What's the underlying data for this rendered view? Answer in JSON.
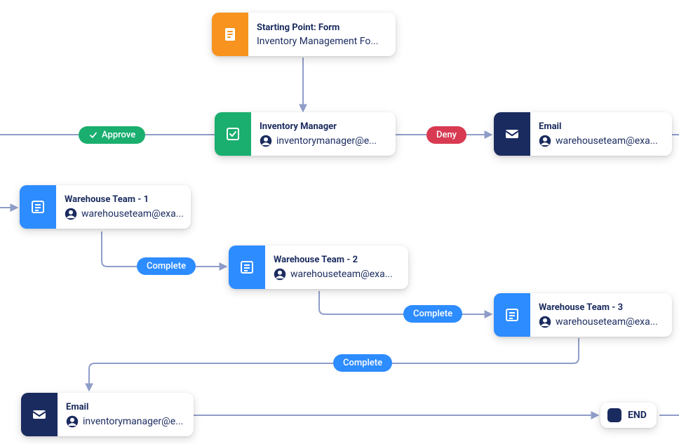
{
  "nodes": {
    "start": {
      "title": "Starting Point: Form",
      "subtitle": "Inventory Management Fo...",
      "iconBg": "#f7931e",
      "icon": "form"
    },
    "manager": {
      "title": "Inventory Manager",
      "subtitle": "inventorymanager@e...",
      "iconBg": "#1aae6f",
      "icon": "task"
    },
    "email1": {
      "title": "Email",
      "subtitle": "warehouseteam@exa...",
      "iconBg": "#1a2b5f",
      "icon": "email"
    },
    "wh1": {
      "title": "Warehouse Team - 1",
      "subtitle": "warehouseteam@exa...",
      "iconBg": "#2d8cff",
      "icon": "list"
    },
    "wh2": {
      "title": "Warehouse Team - 2",
      "subtitle": "warehouseteam@exa...",
      "iconBg": "#2d8cff",
      "icon": "list"
    },
    "wh3": {
      "title": "Warehouse Team - 3",
      "subtitle": "warehouseteam@exa...",
      "iconBg": "#2d8cff",
      "icon": "list"
    },
    "email2": {
      "title": "Email",
      "subtitle": "inventorymanager@e...",
      "iconBg": "#1a2b5f",
      "icon": "email"
    },
    "end": {
      "label": "END"
    }
  },
  "badges": {
    "approve": "Approve",
    "deny": "Deny",
    "complete1": "Complete",
    "complete2": "Complete",
    "complete3": "Complete"
  },
  "colors": {
    "orange": "#f7931e",
    "green": "#1aae6f",
    "blue": "#2d8cff",
    "navy": "#1a2b5f",
    "red": "#d83a52",
    "connector": "#8f9dc9"
  }
}
